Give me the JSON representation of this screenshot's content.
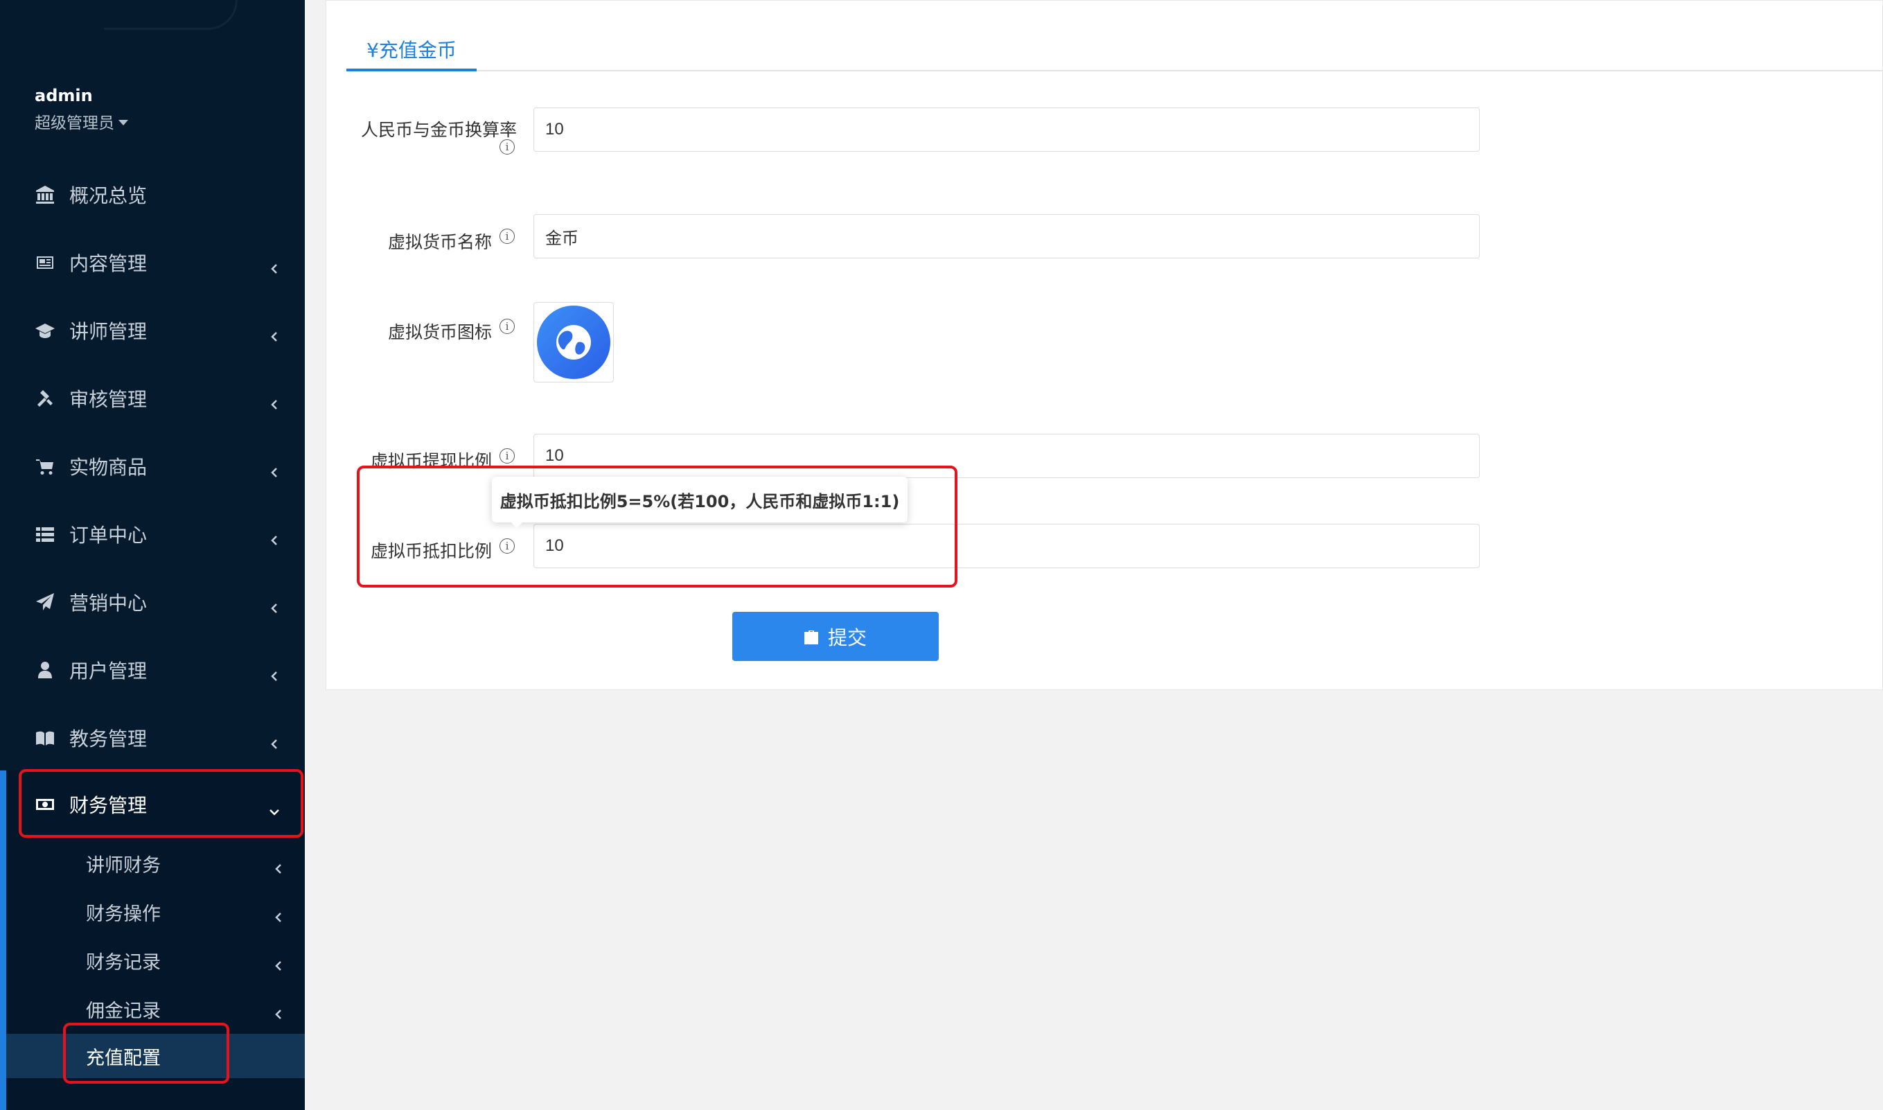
{
  "sidebar": {
    "user_name": "admin",
    "user_role": "超级管理员",
    "menu": [
      {
        "label": "概况总览",
        "icon": "bank-icon"
      },
      {
        "label": "内容管理",
        "icon": "newspaper-icon"
      },
      {
        "label": "讲师管理",
        "icon": "graduation-cap-icon"
      },
      {
        "label": "审核管理",
        "icon": "gavel-icon"
      },
      {
        "label": "实物商品",
        "icon": "cart-icon"
      },
      {
        "label": "订单中心",
        "icon": "list-icon"
      },
      {
        "label": "营销中心",
        "icon": "paper-plane-icon"
      },
      {
        "label": "用户管理",
        "icon": "user-icon"
      },
      {
        "label": "教务管理",
        "icon": "book-icon"
      },
      {
        "label": "财务管理",
        "icon": "money-icon"
      }
    ],
    "finance_submenu": [
      {
        "label": "讲师财务"
      },
      {
        "label": "财务操作"
      },
      {
        "label": "财务记录"
      },
      {
        "label": "佣金记录"
      },
      {
        "label": "充值配置"
      }
    ]
  },
  "tab": {
    "label": "¥充值金币"
  },
  "form": {
    "rate_label": "人民币与金币换算率",
    "rate_value": "10",
    "currency_name_label": "虚拟货币名称",
    "currency_name_value": "金币",
    "currency_icon_label": "虚拟货币图标",
    "withdraw_label": "虚拟币提现比例",
    "withdraw_value": "10",
    "deduct_label": "虚拟币抵扣比例",
    "deduct_value": "10",
    "deduct_tooltip": "虚拟币抵扣比例5=5%(若100，人民币和虚拟币1:1)",
    "info_glyph": "i",
    "submit_label": "提交"
  },
  "colors": {
    "sidebar_bg": "#061a2e",
    "accent": "#1e7fe0",
    "highlight_box": "#e6131c"
  }
}
